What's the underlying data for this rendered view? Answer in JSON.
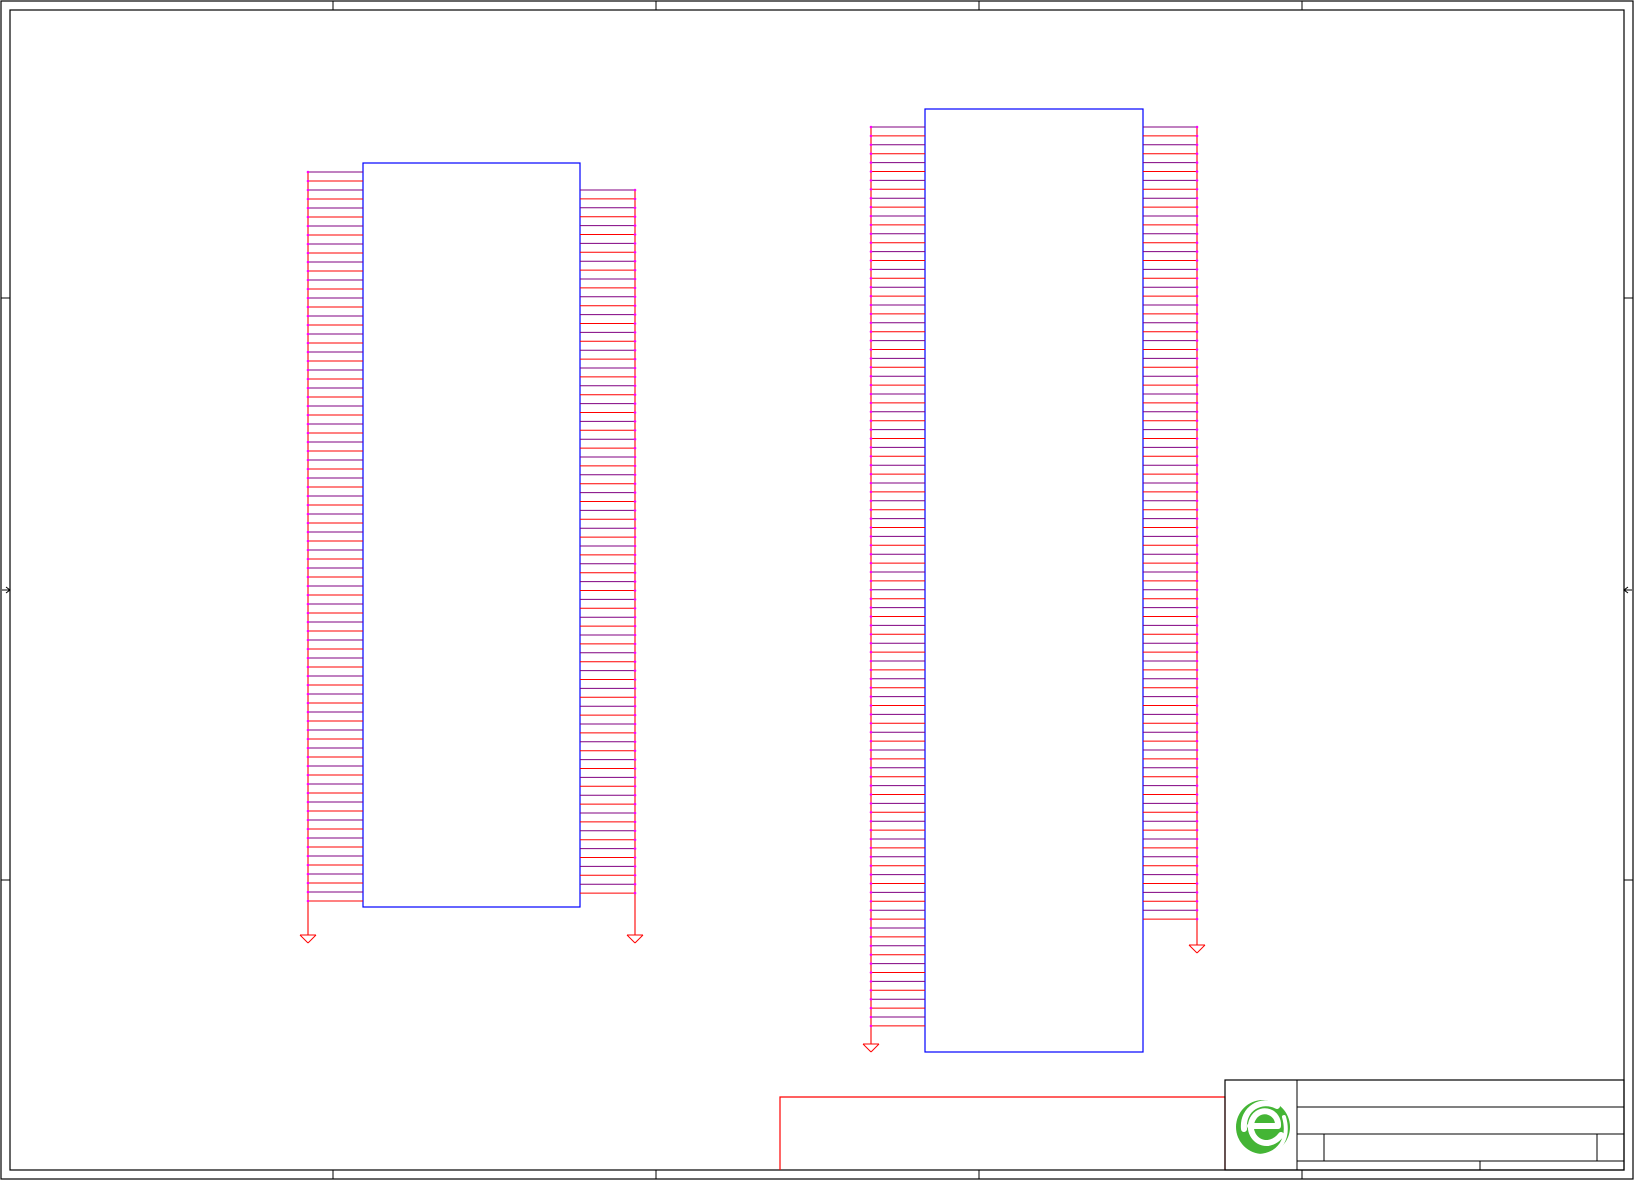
{
  "colors": {
    "background": "#ffffff",
    "frame": "#000000",
    "body_outline": "#0000ff",
    "wire": "#ff0000",
    "pin": "#800080",
    "junction": "#ff00ff",
    "ground": "#ff0000",
    "notes_box": "#ff0000",
    "logo": "#44b535"
  },
  "schematic": {
    "components": [
      {
        "id": "U1",
        "left_pins": 82,
        "right_pins": 80
      },
      {
        "id": "U2",
        "left_pins": 102,
        "right_pins": 90
      }
    ],
    "ground_symbols": 4,
    "title_block": {
      "logo_icon": "company-logo-icon"
    }
  }
}
